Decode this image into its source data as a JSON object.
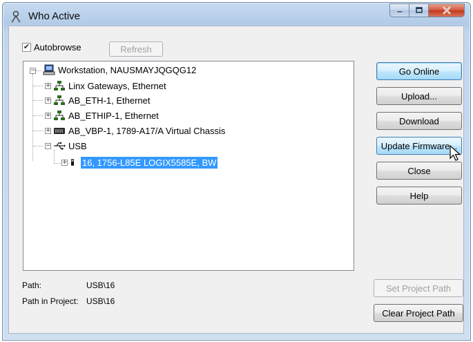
{
  "window": {
    "title": "Who Active",
    "app_icon": "rslinx-graph-icon",
    "controls": {
      "minimize_icon": "minimize-icon",
      "maximize_icon": "maximize-icon",
      "close_icon": "close-icon"
    }
  },
  "autobrowse": {
    "label": "Autobrowse",
    "checked": true
  },
  "refresh_label": "Refresh",
  "tree": {
    "root": {
      "label": "Workstation, NAUSMAYJQGQG12",
      "icon": "workstation-icon",
      "expanded": true
    },
    "children": [
      {
        "label": "Linx Gateways, Ethernet",
        "icon": "network-icon",
        "expanded": false
      },
      {
        "label": "AB_ETH-1, Ethernet",
        "icon": "network-icon",
        "expanded": false
      },
      {
        "label": "AB_ETHIP-1, Ethernet",
        "icon": "network-icon",
        "expanded": false
      },
      {
        "label": "AB_VBP-1, 1789-A17/A Virtual Chassis",
        "icon": "chassis-icon",
        "expanded": false
      },
      {
        "label": "USB",
        "icon": "usb-icon",
        "expanded": true
      }
    ],
    "usb_child": {
      "label": "16, 1756-L85E LOGIX5585E, BW",
      "icon": "controller-icon",
      "selected": true
    }
  },
  "buttons": {
    "go_online": "Go Online",
    "upload": "Upload...",
    "download": "Download",
    "update_firmware": "Update Firmware...",
    "close": "Close",
    "help": "Help",
    "set_project_path": "Set Project Path",
    "clear_project_path": "Clear Project Path"
  },
  "path": {
    "path_label": "Path:",
    "path_value": "USB\\16",
    "project_label": "Path in Project:",
    "project_value": "USB\\16"
  }
}
